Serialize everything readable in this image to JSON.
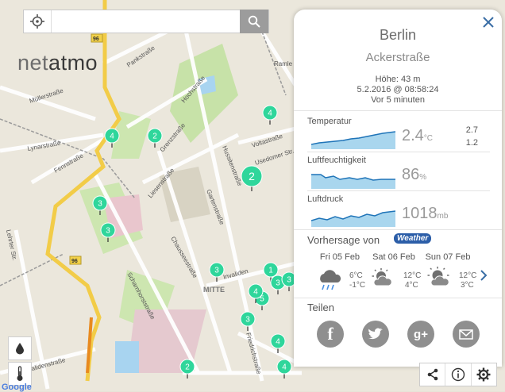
{
  "search": {
    "placeholder": ""
  },
  "logo": {
    "part1": "net",
    "part2": "atmo"
  },
  "map": {
    "streets": [
      "Müllerstraße",
      "Lynarstraße",
      "Fennstraße",
      "Pankstraße",
      "Hochstraße",
      "Grenzstraße",
      "Liesenstraße",
      "Gartenstraße",
      "Hussitenstraße",
      "Voltastraße",
      "Usedomer Str.",
      "Chausseestraße",
      "Scharnhorststraße",
      "Invalidenstraße",
      "Friedrichstraße",
      "Oranienburger Str.",
      "Lehrter Str.",
      "Ramle",
      "MITTE"
    ],
    "road_number": "96",
    "stations": [
      "2",
      "2",
      "4",
      "2",
      "4",
      "2",
      "3",
      "3",
      "3",
      "1",
      "3",
      "3",
      "5",
      "3",
      "4",
      "4",
      "2",
      "2",
      "4"
    ]
  },
  "panel": {
    "city": "Berlin",
    "street": "Ackerstraße",
    "altitude": "Höhe: 43 m",
    "datetime": "5.2.2016 @ 08:58:24",
    "ago": "Vor 5 minuten",
    "close_label": "×",
    "temperature": {
      "label": "Temperatur",
      "value": "2.4",
      "unit": "°C",
      "max": "2.7",
      "min": "1.2"
    },
    "humidity": {
      "label": "Luftfeuchtigkeit",
      "value": "86",
      "unit": "%"
    },
    "pressure": {
      "label": "Luftdruck",
      "value": "1018",
      "unit": "mb"
    },
    "forecast": {
      "title": "Vorhersage von",
      "provider": "Weather",
      "days": [
        {
          "day": "Fri 05 Feb",
          "hi": "6°C",
          "lo": "-1°C",
          "icon": "rain-cloud-icon"
        },
        {
          "day": "Sat 06 Feb",
          "hi": "",
          "lo": "",
          "icon": "sun-cloud-icon"
        },
        {
          "day": "Sun 07 Feb",
          "hi": "12°C",
          "lo": "3°C",
          "icon": "sun-cloud-icon"
        }
      ],
      "extra": {
        "hi": "12°C",
        "lo": "4°C"
      }
    },
    "share_title": "Teilen",
    "share": [
      "facebook-icon",
      "twitter-icon",
      "google-plus-icon",
      "mail-icon"
    ]
  },
  "google": "Google",
  "accent": "#2fd69b"
}
